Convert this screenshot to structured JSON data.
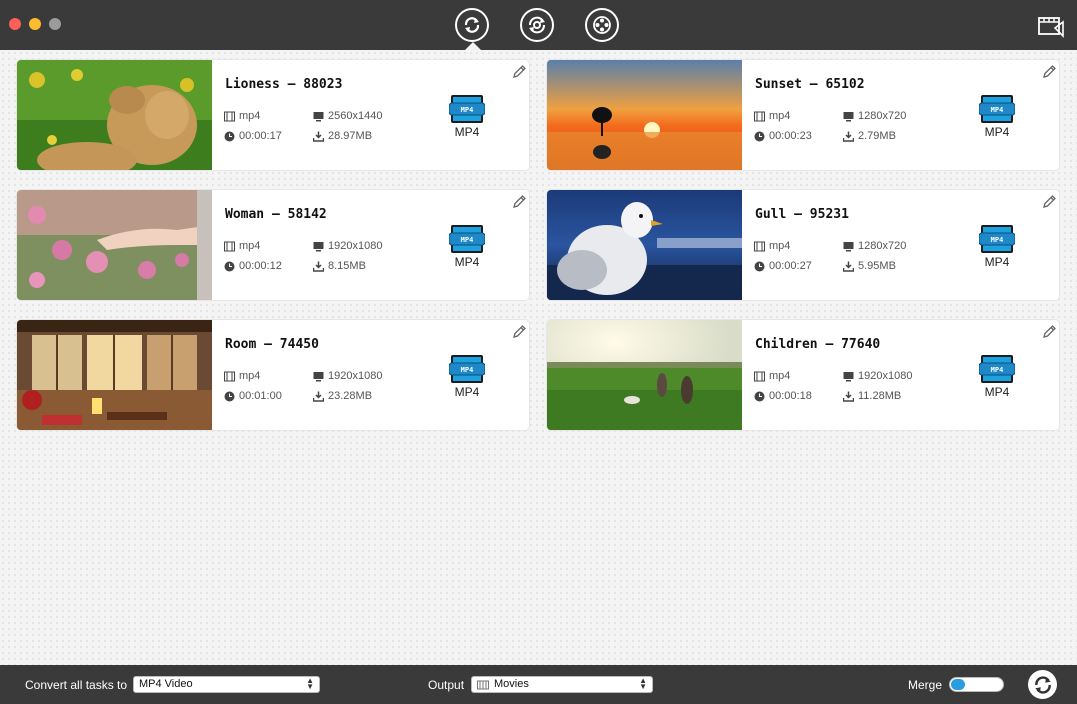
{
  "window": {
    "title": ""
  },
  "toolbar": {
    "tabs": [
      {
        "name": "convert-tab",
        "icon": "convert-arrows-icon",
        "active": true
      },
      {
        "name": "compress-tab",
        "icon": "gear-refresh-icon",
        "active": false
      },
      {
        "name": "record-tab",
        "icon": "film-reel-icon",
        "active": false
      }
    ],
    "right_icon": "media-library-icon"
  },
  "cards": [
    {
      "title": "Lioness – 88023",
      "format": "mp4",
      "resolution": "2560x1440",
      "duration": "00:00:17",
      "size": "28.97MB",
      "output": "MP4",
      "thumb": "lioness"
    },
    {
      "title": "Sunset – 65102",
      "format": "mp4",
      "resolution": "1280x720",
      "duration": "00:00:23",
      "size": "2.79MB",
      "output": "MP4",
      "thumb": "sunset"
    },
    {
      "title": "Woman – 58142",
      "format": "mp4",
      "resolution": "1920x1080",
      "duration": "00:00:12",
      "size": "8.15MB",
      "output": "MP4",
      "thumb": "flowers"
    },
    {
      "title": "Gull – 95231",
      "format": "mp4",
      "resolution": "1280x720",
      "duration": "00:00:27",
      "size": "5.95MB",
      "output": "MP4",
      "thumb": "gull"
    },
    {
      "title": "Room – 74450",
      "format": "mp4",
      "resolution": "1920x1080",
      "duration": "00:01:00",
      "size": "23.28MB",
      "output": "MP4",
      "thumb": "room"
    },
    {
      "title": "Children – 77640",
      "format": "mp4",
      "resolution": "1920x1080",
      "duration": "00:00:18",
      "size": "11.28MB",
      "output": "MP4",
      "thumb": "field"
    }
  ],
  "bottom": {
    "convert_label": "Convert all tasks to",
    "convert_value": "MP4 Video",
    "output_label": "Output",
    "output_value": "Movies",
    "merge_label": "Merge",
    "merge_on": false
  },
  "colors": {
    "accent": "#2a9de0",
    "titlebar": "#3a3a3a"
  }
}
